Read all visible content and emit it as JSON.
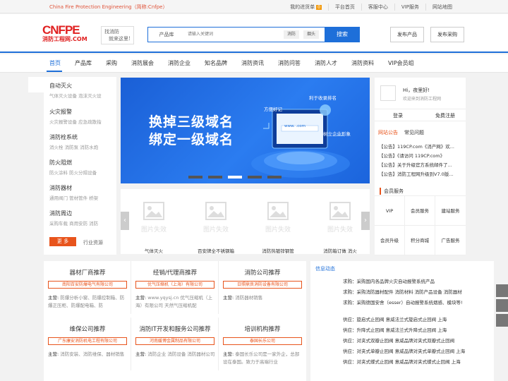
{
  "topbar": {
    "slogan": "China Fire Protection Engineering（简称:Cnfpe）",
    "links": [
      "我的进货单",
      "平台首页",
      "客服中心",
      "VIP服务",
      "网站地图"
    ],
    "cart_count": "0"
  },
  "header": {
    "logo_big": "CNFPE",
    "logo_small": "消防工程网.COM",
    "slogan_line1": "找消防",
    "slogan_line2": "就来这里!",
    "search_category": "产品库",
    "search_placeholder": "请输入关键词",
    "search_tags": [
      "消防",
      "烟头"
    ],
    "search_button": "搜索",
    "publish_product": "发布产品",
    "publish_purchase": "发布采购"
  },
  "nav": [
    "首页",
    "产品库",
    "采购",
    "消防展会",
    "消防企业",
    "知名品牌",
    "消防资讯",
    "消防问答",
    "消防人才",
    "消防资料",
    "VIP会员组"
  ],
  "categories": [
    {
      "title": "自动灭火",
      "sub": "气体灭火设备  泡沫灭火设"
    },
    {
      "title": "火灾报警",
      "sub": "火灾报警设备  应急疏散指"
    },
    {
      "title": "消防栓系统",
      "sub": "消火栓  消防泵  消防水炮"
    },
    {
      "title": "防火阻燃",
      "sub": "防火涂料  防火分隔设备"
    },
    {
      "title": "消防器材",
      "sub": "通用阀门  管材管件  桥架"
    },
    {
      "title": "消防周边",
      "sub": "采购车载  商用安防  消防"
    }
  ],
  "cat_more": "更 多",
  "cat_more_label": "行业资源",
  "banner": {
    "headline1": "换掉三级域名",
    "headline2": "绑定一级域名",
    "tags": [
      "方便好记",
      "利于收录排名",
      "树立企业形象"
    ],
    "url_text": "www.      .com",
    "slides": 5,
    "active_slide": 2
  },
  "products": [
    {
      "caption": "气体灭火",
      "placeholder": "图片失效"
    },
    {
      "caption": "百安牌全不锈钢箱",
      "placeholder": "图片失效"
    },
    {
      "caption": "消防热镀锌钢管",
      "placeholder": "图片失效"
    },
    {
      "caption": "消防箱订做 消火",
      "placeholder": "图片失效"
    }
  ],
  "user": {
    "greeting": "Hi，夜里好!",
    "welcome": "欢迎来到消防工程网",
    "login": "登录",
    "register": "免费注册"
  },
  "notice_tabs": [
    "网站公告",
    "常见问题"
  ],
  "notices": [
    "【公告】119CP.com《消产网》欢...",
    "【公告】《请访问 119CP.com》",
    "【公告】关于升级官方系统邮件了...",
    "【公告】消防工程网升级到V7.0版..."
  ],
  "services_title": "会员服务",
  "services": [
    "VIP",
    "会员服务",
    "建站服务",
    "会员升级",
    "积分商城",
    "广告服务"
  ],
  "recommend": [
    {
      "title": "器材厂商推荐",
      "company": "南阳百安防爆电气有限公司",
      "desc_label": "主营:",
      "desc": "防爆分析小窗、防爆控制箱、防爆正压柜、防爆配电箱、防"
    },
    {
      "title": "经销/代理商推荐",
      "company": "优气压缩机（上海）有限公司",
      "desc_label": "主营:",
      "desc": "www.yqysj.cn 优气压缩机（上海）有限公司 天然气压缩机配"
    },
    {
      "title": "消防公司推荐",
      "company": "日照鼎良消防设备有限公司",
      "desc_label": "主营:",
      "desc": "消防器材销售"
    },
    {
      "title": "维保公司推荐",
      "company": "广东康安消防机电工程有限公司",
      "desc_label": "主营:",
      "desc": "消防安装、消防维保、器材销售"
    },
    {
      "title": "消防IT开发和服务公司推荐",
      "company": "河南媛博金属制品有限公司",
      "desc_label": "主营:",
      "desc": "消防企业 消防设备 消防器材公司"
    },
    {
      "title": "培训机构推荐",
      "company": "泰国长乐公司",
      "desc_label": "主营:",
      "desc": "泰国长乐公司是一家外企，总部设在泰国。致力于高端行业"
    }
  ],
  "info_title": "信息动态",
  "info_items": [
    "求购：采购国内各品牌火灾自动报警系统产品",
    "求购：采购消防器材配件 消防材料 消防产品设备 消防器材",
    "求购：采购德国安舍（esser）自动报警系统烟感、模块等!",
    "",
    "供应：旋启式止回阀 意威法兰式旋启式止回阀 上海",
    "供应：升降式止回阀 意威法兰式升降式止回阀 上海",
    "供应：对夹式双瓣止回阀 意威品牌对夹式双瓣式止回阀",
    "供应：对夹式单瓣止回阀 意威品牌对夹式单瓣式止回阀 上海",
    "供应：对夹式蝶式止回阀 意威品牌对夹式蝶式止回阀 上海"
  ],
  "colors": {
    "brand_blue": "#1e6fd9",
    "accent_orange": "#e8541c",
    "logo_red": "#e02020"
  }
}
